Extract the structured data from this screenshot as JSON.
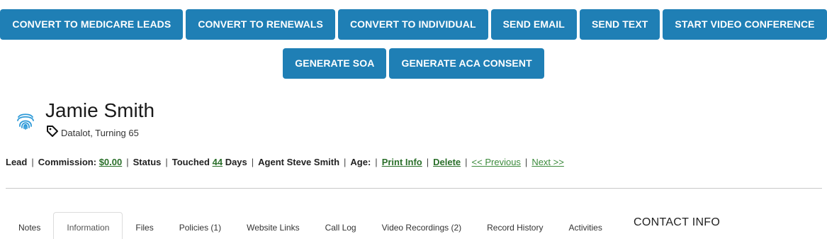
{
  "actions": {
    "row1": [
      "CONVERT TO MEDICARE LEADS",
      "CONVERT TO RENEWALS",
      "CONVERT TO INDIVIDUAL",
      "SEND EMAIL",
      "SEND TEXT",
      "START VIDEO CONFERENCE"
    ],
    "row2": [
      "GENERATE SOA",
      "GENERATE ACA CONSENT"
    ]
  },
  "contact": {
    "name": "Jamie Smith",
    "tags": "Datalot, Turning 65"
  },
  "meta": {
    "type": "Lead",
    "commission_label": "Commission:",
    "commission_value": "$0.00",
    "status_label": "Status",
    "touched_label": "Touched",
    "touched_days": "44",
    "days_label": "Days",
    "agent": "Agent Steve Smith",
    "age_label": "Age:",
    "print_info": "Print Info",
    "delete": "Delete",
    "previous": "<< Previous",
    "next": "Next >>"
  },
  "tabs": [
    "Notes",
    "Information",
    "Files",
    "Policies (1)",
    "Website Links",
    "Call Log",
    "Video Recordings (2)",
    "Record History",
    "Activities"
  ],
  "active_tab": "Information",
  "contact_info_title": "CONTACT INFO",
  "colors": {
    "button_bg": "#1f7fb5",
    "link": "#2a6f2a",
    "icon_blue": "#2e9ad8"
  }
}
